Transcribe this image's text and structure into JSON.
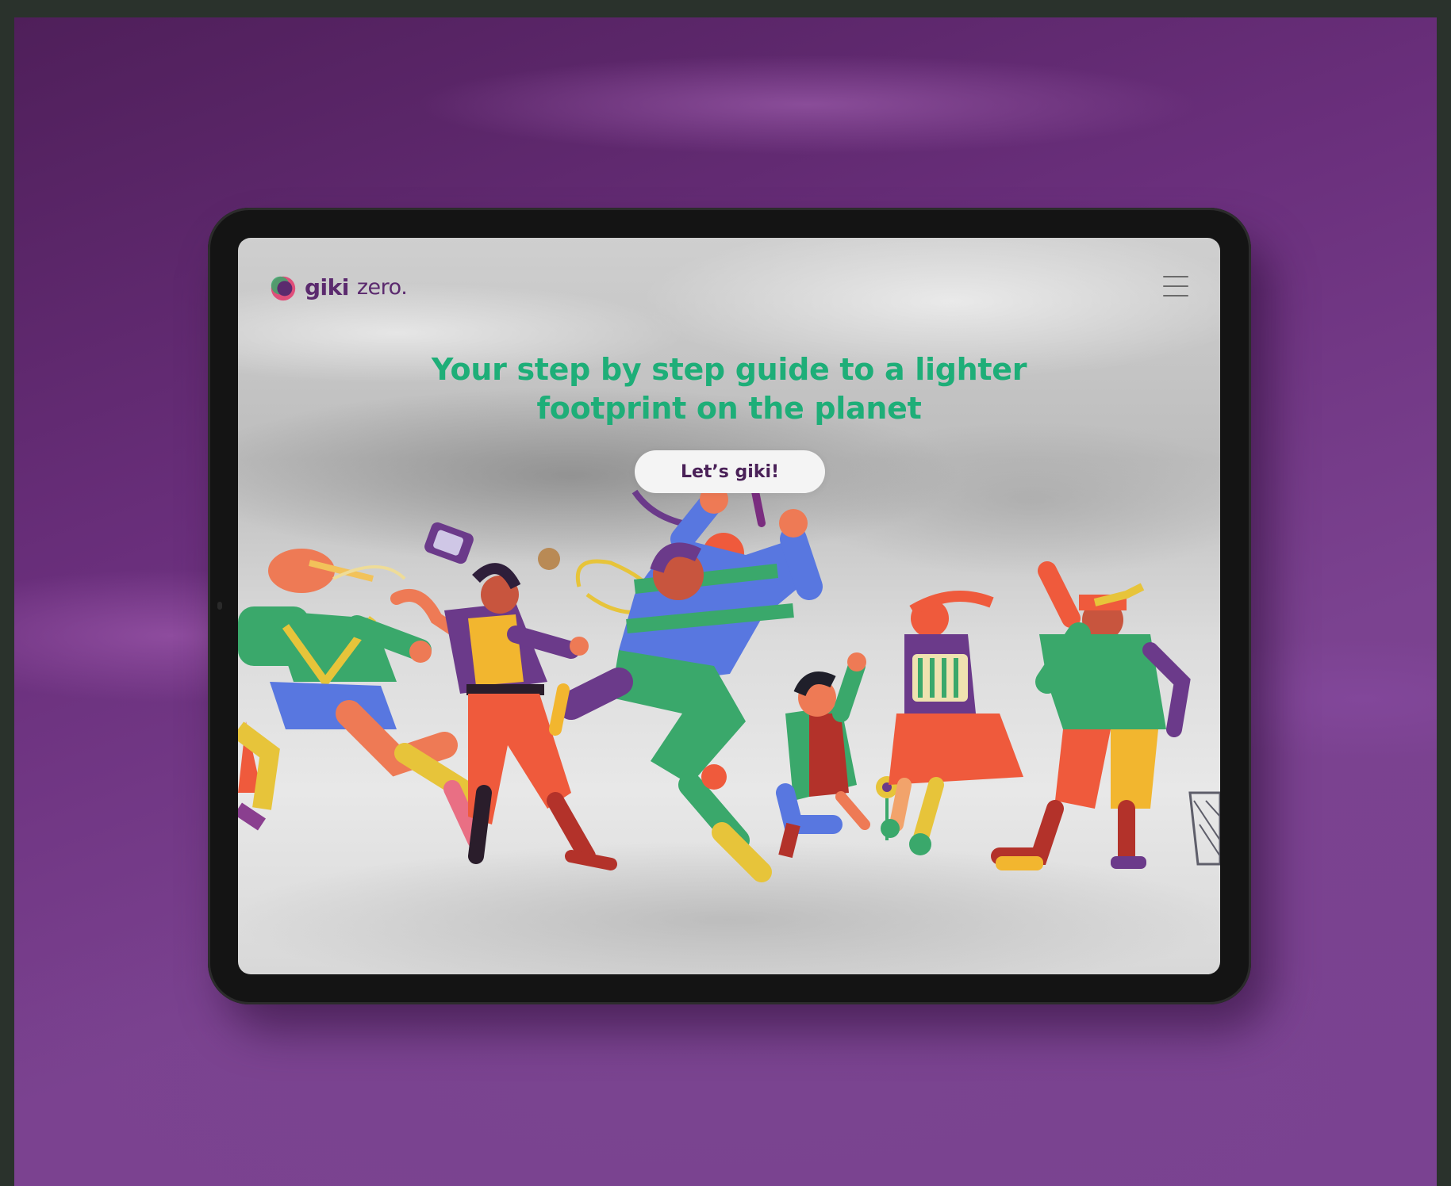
{
  "brand": {
    "name_bold": "giki",
    "name_light": "zero."
  },
  "hero": {
    "headline_line1": "Your step by step guide to a lighter",
    "headline_line2": "footprint on the planet",
    "cta_label": "Let’s giki!"
  },
  "colors": {
    "headline": "#1eae78",
    "brand_purple": "#5b2a6e",
    "backdrop_purple": "#7a4291",
    "device_frame": "#141414"
  },
  "icons": {
    "logo": "giki-logo-icon",
    "menu": "hamburger-menu-icon"
  }
}
